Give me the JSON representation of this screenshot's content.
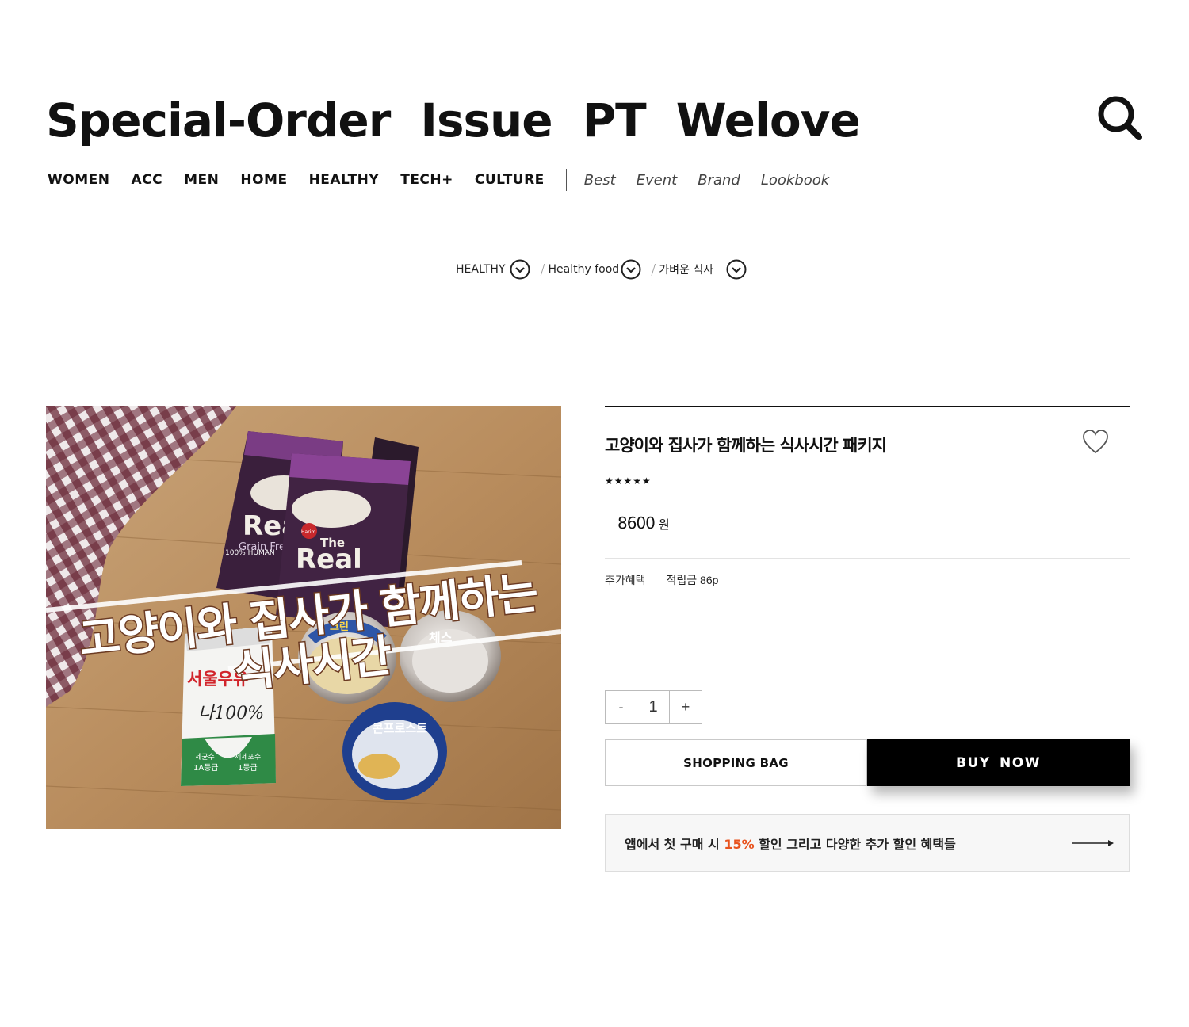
{
  "site": {
    "title_words": [
      "Special-Order",
      "Issue",
      "PT",
      "Welove"
    ]
  },
  "nav": {
    "categories": [
      "WOMEN",
      "ACC",
      "MEN",
      "HOME",
      "HEALTHY",
      "TECH+",
      "CULTURE"
    ],
    "secondary": [
      "Best",
      "Event",
      "Brand",
      "Lookbook"
    ]
  },
  "breadcrumb": {
    "items": [
      "HEALTHY",
      "Healthy food",
      "가벼운 식사"
    ],
    "separator": "/"
  },
  "product": {
    "name": "고양이와 집사가 함께하는 식사시간 패키지",
    "rating_stars": "★★★★★",
    "rating": 5,
    "price": "8600",
    "currency": "원",
    "benefit_label": "추가혜택",
    "benefit_value": "적립금 86p",
    "image": {
      "overlay_line1": "고양이와 집사가 함께하는",
      "overlay_line2": "식사시간",
      "milk_brand": "서울우유",
      "milk_text": "나100%",
      "milk_grade_left_1": "세균수",
      "milk_grade_left_2": "1A등급",
      "milk_grade_right_1": "체세포수",
      "milk_grade_right_2": "1등급",
      "pouch_brand": "Harim",
      "pouch_title": "The",
      "pouch_word": "Real",
      "pouch_sub": "Grain Free",
      "pouch_note": "100% HUMAN",
      "bowl1": "크런",
      "bowl2": "체스",
      "bowl3": "콘프로스트"
    }
  },
  "quantity": {
    "minus": "-",
    "value": "1",
    "plus": "+"
  },
  "actions": {
    "bag_label": "SHOPPING BAG",
    "buy_label": "BUY NOW"
  },
  "promo": {
    "prefix": "앱에서 첫 구매 시 ",
    "highlight": "15%",
    "suffix": " 할인 그리고 다양한 추가 할인 혜택들",
    "accent_color": "#e8531e"
  },
  "icons": {
    "search": "search-icon",
    "chevron": "chevron-down-icon",
    "wish": "heart-icon",
    "arrow": "arrow-right-icon"
  }
}
